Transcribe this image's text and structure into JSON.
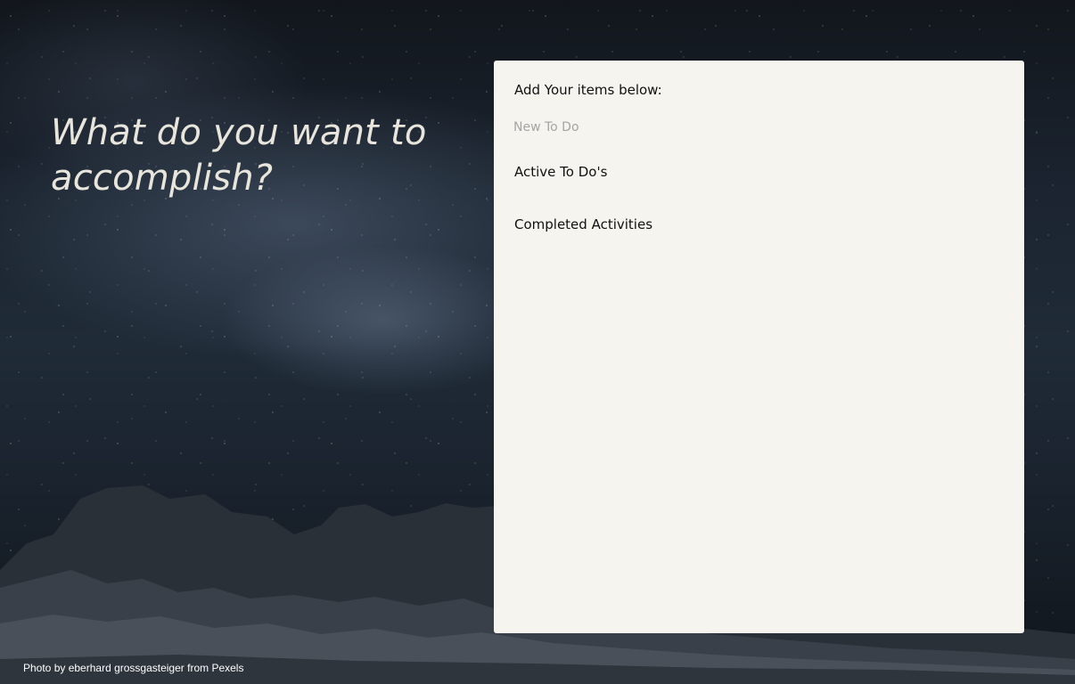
{
  "hero": {
    "headline": "What do you want to accomplish?"
  },
  "panel": {
    "heading": "Add Your items below:",
    "new_todo_input": {
      "placeholder": "New To Do",
      "value": ""
    },
    "active_section": {
      "title": "Active To Do's",
      "items": []
    },
    "completed_section": {
      "title": "Completed Activities",
      "items": []
    }
  },
  "footer": {
    "photo_credit": "Photo by eberhard grossgasteiger from Pexels"
  },
  "colors": {
    "panel_background": "#f5f4ee",
    "headline_text": "#e8e6dc",
    "placeholder_text": "#a5a5a5"
  }
}
